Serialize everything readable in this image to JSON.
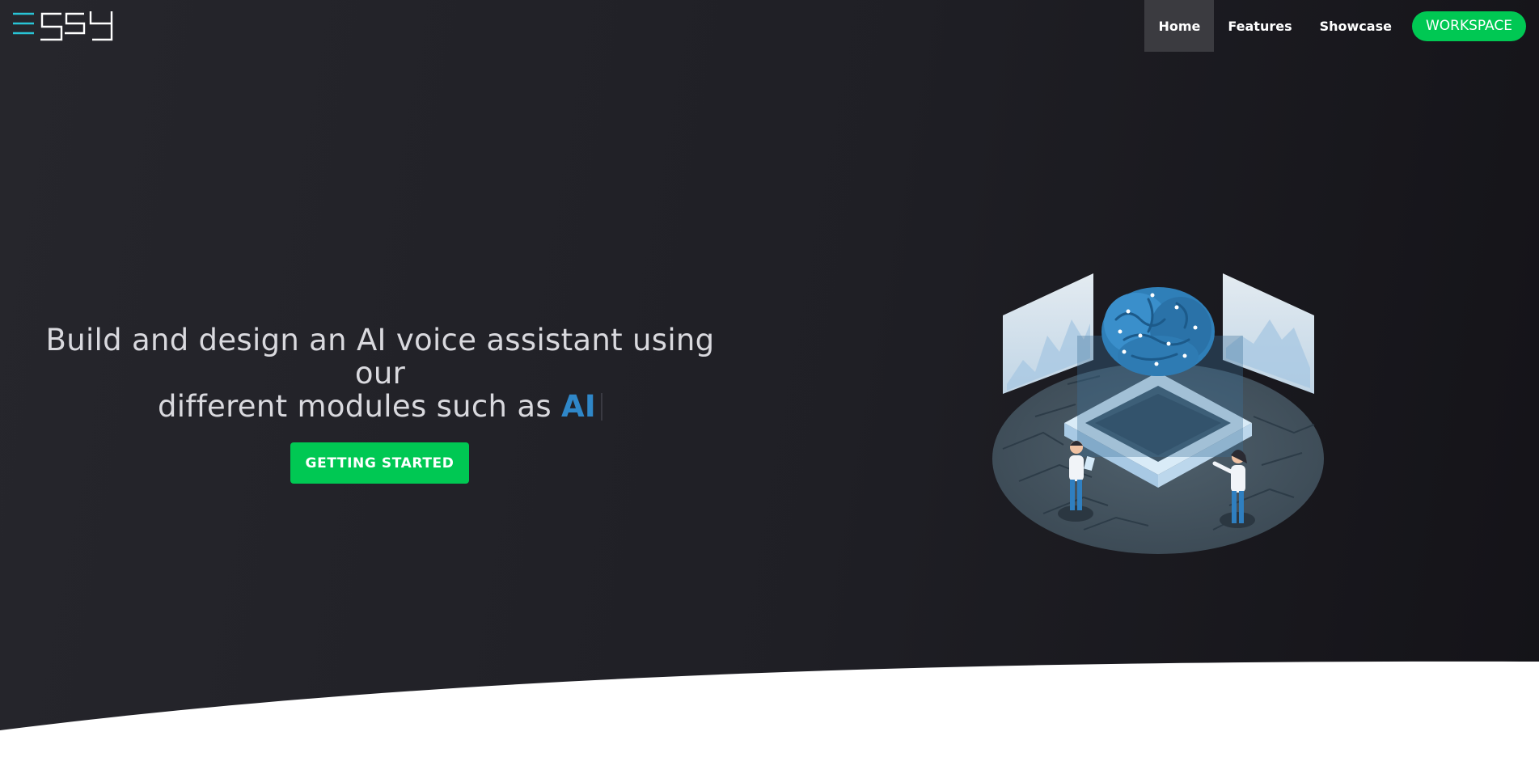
{
  "brand": {
    "logo_text": "EGSY",
    "logo_accent_color": "#29c4d6"
  },
  "nav": {
    "items": [
      {
        "label": "Home",
        "active": true
      },
      {
        "label": "Features",
        "active": false
      },
      {
        "label": "Showcase",
        "active": false
      }
    ],
    "workspace_label": "WORKSPACE"
  },
  "hero": {
    "headline_line1": "Build and design an AI voice assistant using our",
    "headline_line2": "different modules such as ",
    "highlight_word": "AI",
    "cta_label": "GETTING STARTED"
  },
  "colors": {
    "accent_green": "#00c853",
    "highlight_blue": "#2f87c8",
    "hero_dark": "#1f1f25"
  },
  "illustration": {
    "icon": "ai-brain-lab-illustration"
  }
}
